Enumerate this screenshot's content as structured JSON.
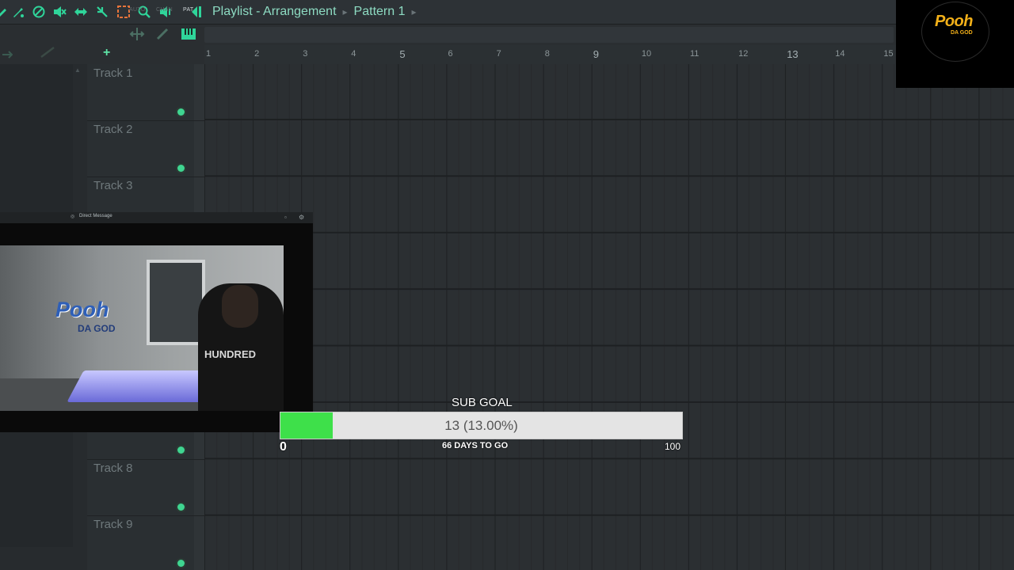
{
  "toolbar": {
    "tools": [
      "draw-icon",
      "paint-icon",
      "delete-icon",
      "mute-icon",
      "slip-icon",
      "slice-icon",
      "select-icon",
      "zoom-icon",
      "playback-icon"
    ],
    "accent_color": "#2fd59a"
  },
  "window": {
    "title_parts": [
      "Playlist - Arrangement",
      "Pattern 1"
    ]
  },
  "header": {
    "labels": [
      "AUTO",
      "CHAN",
      "PAT"
    ]
  },
  "ruler": {
    "bars": [
      "1",
      "2",
      "3",
      "4",
      "5",
      "6",
      "7",
      "8",
      "9",
      "10",
      "11",
      "12",
      "13",
      "14",
      "15"
    ],
    "major_bars": [
      "5",
      "9",
      "13"
    ]
  },
  "tracks": [
    {
      "label": "Track 1"
    },
    {
      "label": "Track 2"
    },
    {
      "label": "Track 3"
    },
    {
      "label": "Track 8"
    },
    {
      "label": "Track 9"
    }
  ],
  "logo": {
    "text": "Pooh",
    "sub": "DA GOD"
  },
  "webcam": {
    "window_title": "Direct Message",
    "logo_text": "Pooh",
    "logo_sub": "DA GOD",
    "shirt_text": "HUNDRED"
  },
  "sub_goal": {
    "label": "SUB GOAL",
    "current": 13,
    "target": 100,
    "fraction": 0.13,
    "progress_text": "13 (13.00%)",
    "min_label": "0",
    "max_label": "100",
    "days_text": "66 DAYS TO GO",
    "fill_color": "#3ee04a"
  }
}
